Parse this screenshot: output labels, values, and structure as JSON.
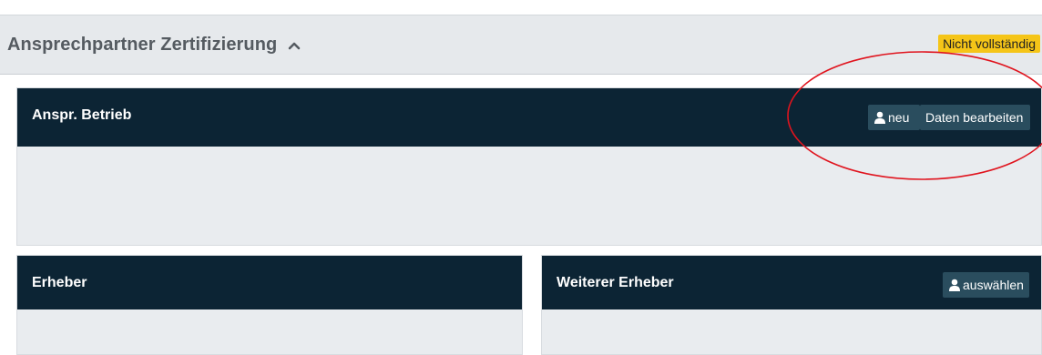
{
  "section": {
    "title": "Ansprechpartner Zertifizierung",
    "status_badge": "Nicht vollständig"
  },
  "panels": {
    "betrieb": {
      "title": "Anspr. Betrieb",
      "new_button": "neu",
      "edit_button": "Daten bearbeiten"
    },
    "erheber": {
      "title": "Erheber"
    },
    "weiterer": {
      "title": "Weiterer Erheber",
      "select_button": "auswählen"
    }
  },
  "icons": {
    "collapse": "chevron-up-icon",
    "person": "person-icon"
  },
  "colors": {
    "panel_header": "#0c2434",
    "button": "#2a4d5e",
    "badge": "#f5c518",
    "annotation": "#e0141e"
  }
}
